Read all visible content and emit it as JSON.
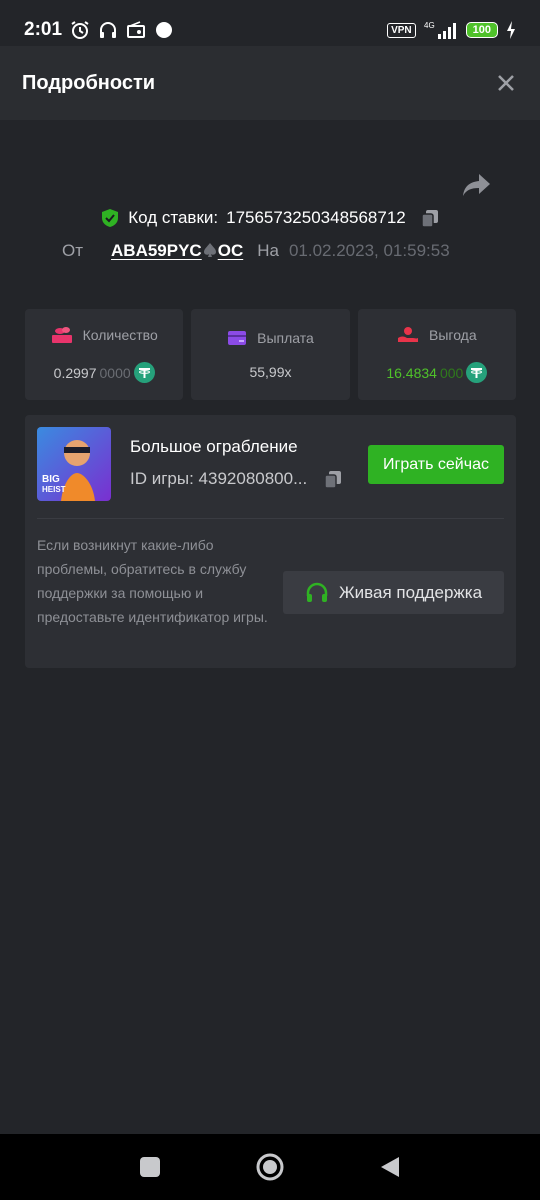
{
  "status_bar": {
    "time": "2:01",
    "vpn": "VPN",
    "network": "4G",
    "battery": "100"
  },
  "header": {
    "title": "Подробности"
  },
  "bet": {
    "code_label": "Код ставки:",
    "code_value": "1756573250348568712",
    "from_label": "От",
    "username": "ABA59PYC",
    "username_suffix": "OC",
    "on_label": "На",
    "datetime": "01.02.2023, 01:59:53"
  },
  "stats": [
    {
      "label": "Количество",
      "value_main": "0.2997",
      "value_trail": "0000",
      "icon": "coins-icon",
      "color": "#e8346b"
    },
    {
      "label": "Выплата",
      "value_main": "55,99x",
      "value_trail": "",
      "icon": "card-icon",
      "color": "#8b4be6"
    },
    {
      "label": "Выгода",
      "value_main": "16.4834",
      "value_trail": "000",
      "icon": "hand-coin-icon",
      "color": "#e8344a"
    }
  ],
  "game": {
    "title": "Большое ограбление",
    "id_label": "ID игры: 4392080800...",
    "thumb_text_1": "BIG",
    "thumb_text_2": "HEIST",
    "play_button": "Играть сейчас"
  },
  "support": {
    "help_text": "Если возникнут какие-либо проблемы, обратитесь в службу поддержки за помощью и предоставьте идентификатор игры.",
    "button_label": "Живая поддержка"
  },
  "colors": {
    "accent_green": "#2fb223",
    "background": "#232529",
    "card": "#2d2f34"
  }
}
